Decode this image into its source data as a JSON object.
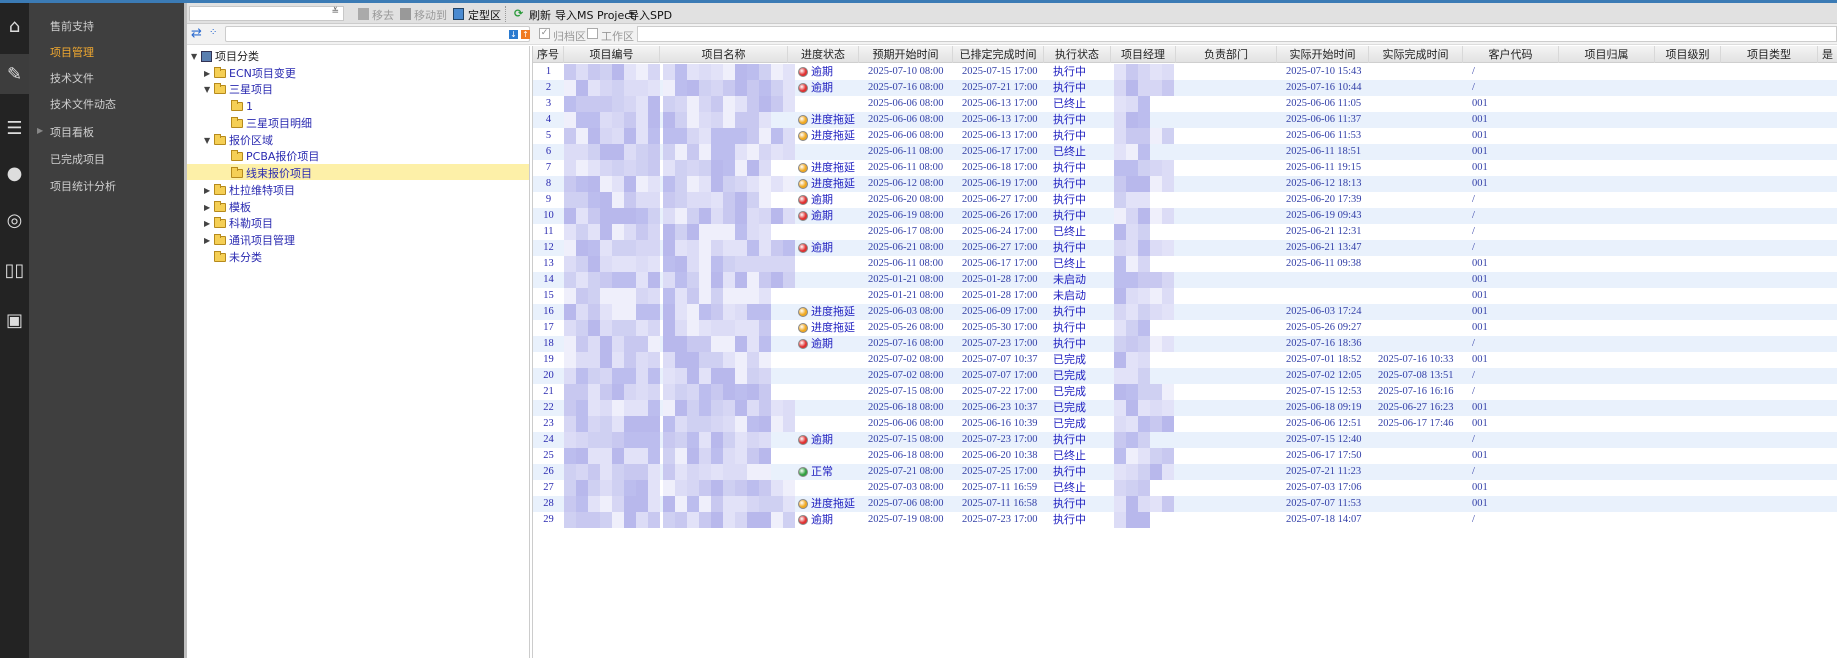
{
  "colors": {
    "accent": "#f0a830",
    "topline": "#3b7bb5",
    "overdue": "#e03030",
    "delayed": "#f0a820",
    "normal": "#30a040",
    "text_blue": "#2020c0"
  },
  "iconbar": [
    "home-icon",
    "edit-icon",
    "database-icon",
    "chat-icon",
    "broadcast-icon",
    "book-icon",
    "id-card-icon"
  ],
  "menu": {
    "items": [
      {
        "label": "售前支持"
      },
      {
        "label": "项目管理",
        "active": true
      },
      {
        "label": "技术文件"
      },
      {
        "label": "技术文件动态"
      },
      {
        "label": "项目看板",
        "expandable": true
      },
      {
        "label": "已完成项目"
      },
      {
        "label": "项目统计分析"
      }
    ]
  },
  "toolbar": {
    "select_value": "",
    "remove": "移去",
    "move_to": "移动到",
    "finalize": "定型区",
    "refresh": "刷新",
    "import_msp": "导入MS Project",
    "import_spd": "导入SPD"
  },
  "filters": {
    "tree_search": "",
    "archive": "归档区",
    "archive_checked": true,
    "work": "工作区",
    "work_checked": false,
    "grid_filter": ""
  },
  "tree": {
    "nodes": [
      {
        "label": "项目分类",
        "level": 0,
        "state": "expanded",
        "root": true
      },
      {
        "label": "ECN项目变更",
        "level": 1,
        "state": "collapsed"
      },
      {
        "label": "三星项目",
        "level": 1,
        "state": "expanded"
      },
      {
        "label": "1",
        "level": 2
      },
      {
        "label": "三星项目明细",
        "level": 2
      },
      {
        "label": "报价区域",
        "level": 1,
        "state": "expanded"
      },
      {
        "label": "PCBA报价项目",
        "level": 2
      },
      {
        "label": "线束报价项目",
        "level": 2,
        "selected": true
      },
      {
        "label": "杜拉维特项目",
        "level": 1,
        "state": "collapsed"
      },
      {
        "label": "模板",
        "level": 1,
        "state": "collapsed"
      },
      {
        "label": "科勒项目",
        "level": 1,
        "state": "collapsed"
      },
      {
        "label": "通讯项目管理",
        "level": 1,
        "state": "collapsed"
      },
      {
        "label": "未分类",
        "level": 1
      }
    ]
  },
  "grid": {
    "columns": [
      "序号",
      "项目编号",
      "项目名称",
      "进度状态",
      "预期开始时间",
      "已排定完成时间",
      "执行状态",
      "项目经理",
      "负责部门",
      "实际开始时间",
      "实际完成时间",
      "客户代码",
      "项目归属",
      "项目级别",
      "项目类型",
      "是"
    ],
    "rows": [
      [
        "1",
        "逾期",
        "2025-07-10 08:00",
        "2025-07-15 17:00",
        "执行中",
        "2025-07-10 15:43",
        "",
        "/"
      ],
      [
        "2",
        "逾期",
        "2025-07-16 08:00",
        "2025-07-21 17:00",
        "执行中",
        "2025-07-16 10:44",
        "",
        "/"
      ],
      [
        "3",
        "",
        "2025-06-06 08:00",
        "2025-06-13 17:00",
        "已终止",
        "2025-06-06 11:05",
        "",
        "001"
      ],
      [
        "4",
        "进度拖延",
        "2025-06-06 08:00",
        "2025-06-13 17:00",
        "执行中",
        "2025-06-06 11:37",
        "",
        "001"
      ],
      [
        "5",
        "进度拖延",
        "2025-06-06 08:00",
        "2025-06-13 17:00",
        "执行中",
        "2025-06-06 11:53",
        "",
        "001"
      ],
      [
        "6",
        "",
        "2025-06-11 08:00",
        "2025-06-17 17:00",
        "已终止",
        "2025-06-11 18:51",
        "",
        "001"
      ],
      [
        "7",
        "进度拖延",
        "2025-06-11 08:00",
        "2025-06-18 17:00",
        "执行中",
        "2025-06-11 19:15",
        "",
        "001"
      ],
      [
        "8",
        "进度拖延",
        "2025-06-12 08:00",
        "2025-06-19 17:00",
        "执行中",
        "2025-06-12 18:13",
        "",
        "001"
      ],
      [
        "9",
        "逾期",
        "2025-06-20 08:00",
        "2025-06-27 17:00",
        "执行中",
        "2025-06-20 17:39",
        "",
        "/"
      ],
      [
        "10",
        "逾期",
        "2025-06-19 08:00",
        "2025-06-26 17:00",
        "执行中",
        "2025-06-19 09:43",
        "",
        "/"
      ],
      [
        "11",
        "",
        "2025-06-17 08:00",
        "2025-06-24 17:00",
        "已终止",
        "2025-06-21 12:31",
        "",
        "/"
      ],
      [
        "12",
        "逾期",
        "2025-06-21 08:00",
        "2025-06-27 17:00",
        "执行中",
        "2025-06-21 13:47",
        "",
        "/"
      ],
      [
        "13",
        "",
        "2025-06-11 08:00",
        "2025-06-17 17:00",
        "已终止",
        "2025-06-11 09:38",
        "",
        "001"
      ],
      [
        "14",
        "",
        "2025-01-21 08:00",
        "2025-01-28 17:00",
        "未启动",
        "",
        "",
        "001"
      ],
      [
        "15",
        "",
        "2025-01-21 08:00",
        "2025-01-28 17:00",
        "未启动",
        "",
        "",
        "001"
      ],
      [
        "16",
        "进度拖延",
        "2025-06-03 08:00",
        "2025-06-09 17:00",
        "执行中",
        "2025-06-03 17:24",
        "",
        "001"
      ],
      [
        "17",
        "进度拖延",
        "2025-05-26 08:00",
        "2025-05-30 17:00",
        "执行中",
        "2025-05-26 09:27",
        "",
        "001"
      ],
      [
        "18",
        "逾期",
        "2025-07-16 08:00",
        "2025-07-23 17:00",
        "执行中",
        "2025-07-16 18:36",
        "",
        "/"
      ],
      [
        "19",
        "",
        "2025-07-02 08:00",
        "2025-07-07 10:37",
        "已完成",
        "2025-07-01 18:52",
        "2025-07-16 10:33",
        "001"
      ],
      [
        "20",
        "",
        "2025-07-02 08:00",
        "2025-07-07 17:00",
        "已完成",
        "2025-07-02 12:05",
        "2025-07-08 13:51",
        "/"
      ],
      [
        "21",
        "",
        "2025-07-15 08:00",
        "2025-07-22 17:00",
        "已完成",
        "2025-07-15 12:53",
        "2025-07-16 16:16",
        "/"
      ],
      [
        "22",
        "",
        "2025-06-18 08:00",
        "2025-06-23 10:37",
        "已完成",
        "2025-06-18 09:19",
        "2025-06-27 16:23",
        "001"
      ],
      [
        "23",
        "",
        "2025-06-06 08:00",
        "2025-06-16 10:39",
        "已完成",
        "2025-06-06 12:51",
        "2025-06-17 17:46",
        "001"
      ],
      [
        "24",
        "逾期",
        "2025-07-15 08:00",
        "2025-07-23 17:00",
        "执行中",
        "2025-07-15 12:40",
        "",
        "/"
      ],
      [
        "25",
        "",
        "2025-06-18 08:00",
        "2025-06-20 10:38",
        "已终止",
        "2025-06-17 17:50",
        "",
        "001"
      ],
      [
        "26",
        "正常",
        "2025-07-21 08:00",
        "2025-07-25 17:00",
        "执行中",
        "2025-07-21 11:23",
        "",
        "/"
      ],
      [
        "27",
        "",
        "2025-07-03 08:00",
        "2025-07-11 16:59",
        "已终止",
        "2025-07-03 17:06",
        "",
        "001"
      ],
      [
        "28",
        "进度拖延",
        "2025-07-06 08:00",
        "2025-07-11 16:58",
        "执行中",
        "2025-07-07 11:53",
        "",
        "001"
      ],
      [
        "29",
        "逾期",
        "2025-07-19 08:00",
        "2025-07-23 17:00",
        "执行中",
        "2025-07-18 14:07",
        "",
        "/"
      ]
    ]
  }
}
